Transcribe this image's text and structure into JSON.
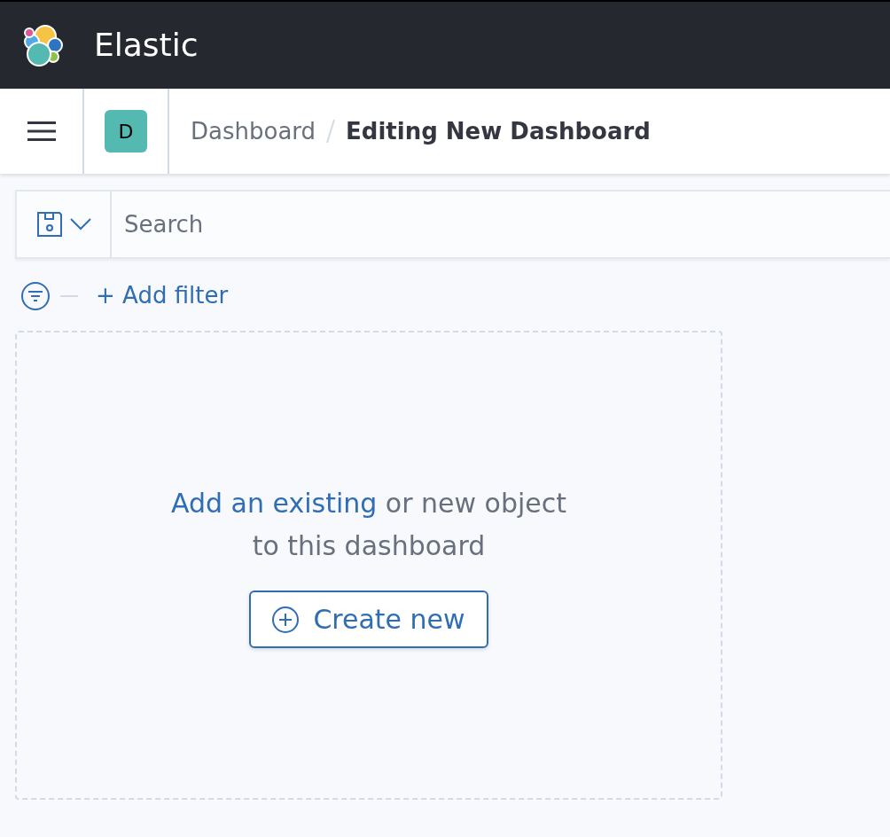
{
  "header": {
    "title": "Elastic"
  },
  "breadcrumb_bar": {
    "space_avatar": "D",
    "breadcrumbs": [
      {
        "label": "Dashboard",
        "current": false
      },
      {
        "label": "Editing New Dashboard",
        "current": true
      }
    ]
  },
  "query_bar": {
    "placeholder": "Search"
  },
  "filter_bar": {
    "add_filter": "+ Add filter"
  },
  "empty_panel": {
    "link": "Add an existing",
    "text": " or new object to this dashboard",
    "button": "Create new"
  }
}
